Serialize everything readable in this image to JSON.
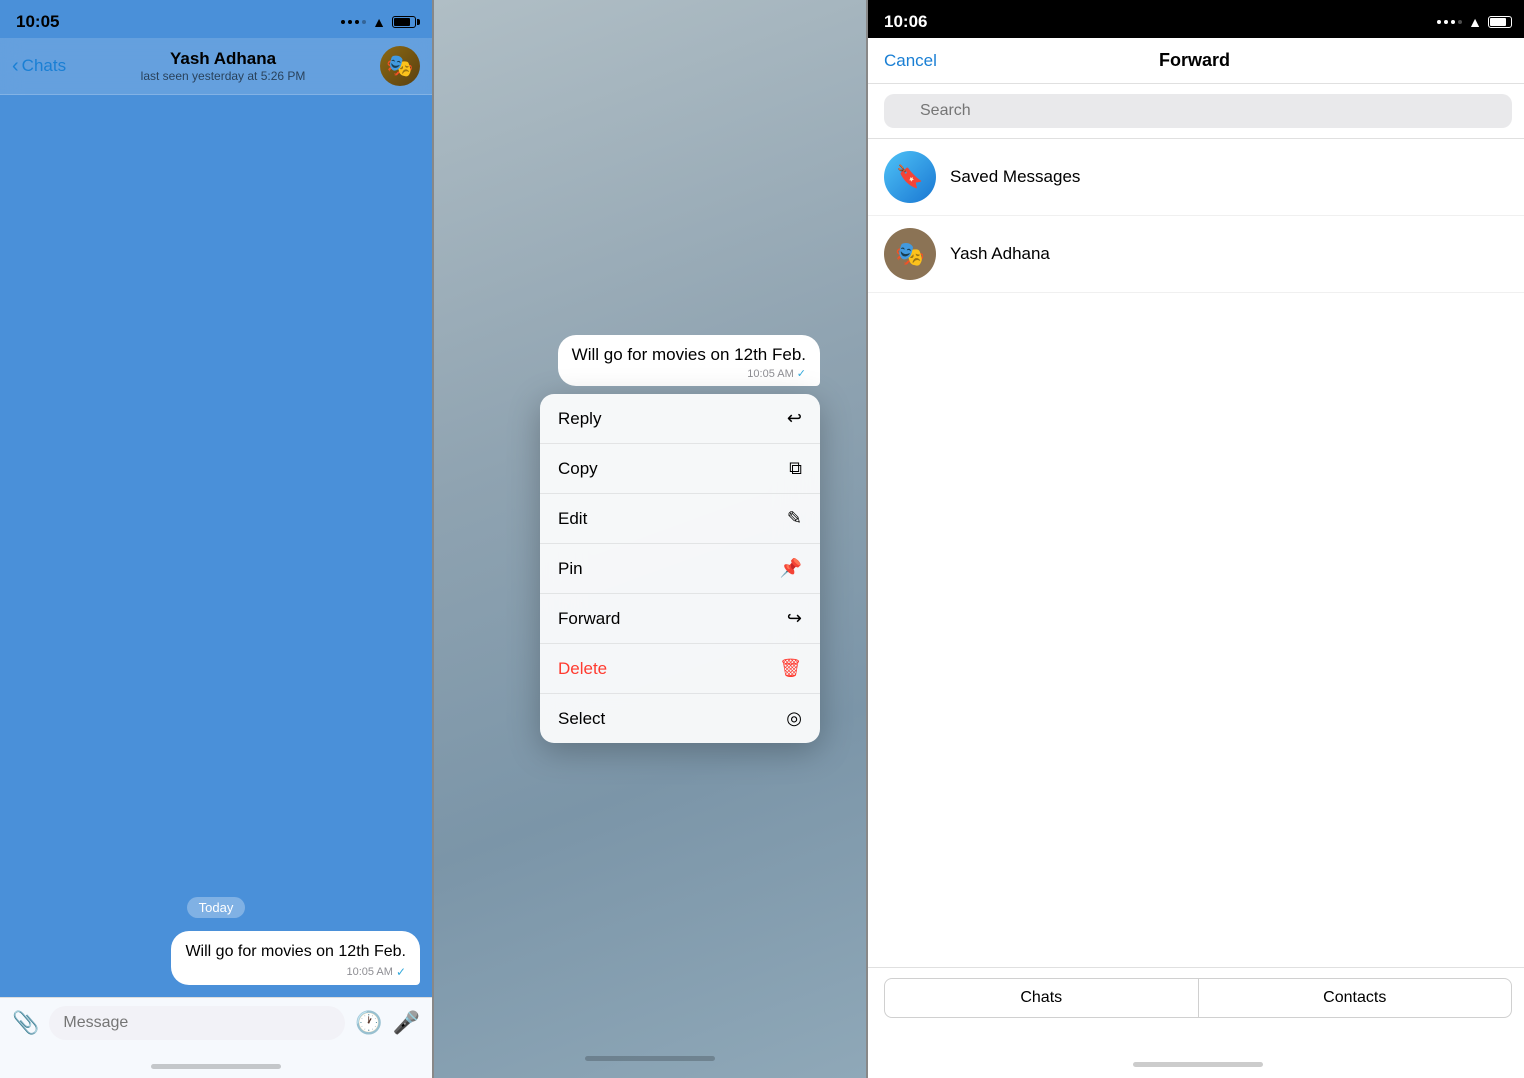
{
  "panel1": {
    "status_time": "10:05",
    "header": {
      "back_label": "Chats",
      "contact_name": "Yash Adhana",
      "contact_status": "last seen yesterday at 5:26 PM"
    },
    "messages": [
      {
        "date_badge": "Today",
        "text": "Will go for movies on 12th Feb.",
        "time": "10:05 AM",
        "check": "✓"
      }
    ],
    "input": {
      "placeholder": "Message"
    }
  },
  "panel2": {
    "message": {
      "text": "Will go for movies on 12th Feb.",
      "time": "10:05 AM",
      "check": "✓"
    },
    "menu_items": [
      {
        "label": "Reply",
        "icon": "↩",
        "type": "normal"
      },
      {
        "label": "Copy",
        "icon": "⧉",
        "type": "normal"
      },
      {
        "label": "Edit",
        "icon": "✎",
        "type": "normal"
      },
      {
        "label": "Pin",
        "icon": "📌",
        "type": "normal"
      },
      {
        "label": "Forward",
        "icon": "↪",
        "type": "normal"
      },
      {
        "label": "Delete",
        "icon": "🗑",
        "type": "delete"
      },
      {
        "label": "Select",
        "icon": "◎",
        "type": "normal"
      }
    ]
  },
  "panel3": {
    "status_time": "10:06",
    "header": {
      "cancel_label": "Cancel",
      "title": "Forward"
    },
    "search": {
      "placeholder": "Search"
    },
    "contacts": [
      {
        "name": "Saved Messages",
        "type": "saved",
        "icon": "🔖"
      },
      {
        "name": "Yash Adhana",
        "type": "contact",
        "icon": "🎭"
      }
    ],
    "tabs": [
      {
        "label": "Chats"
      },
      {
        "label": "Contacts"
      }
    ]
  }
}
